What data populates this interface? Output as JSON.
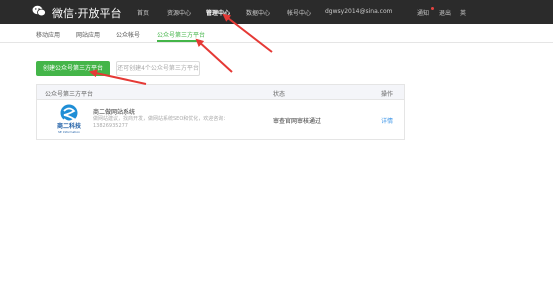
{
  "colors": {
    "topbar_bg": "#2b2b2b",
    "accent_green": "#44b549",
    "annotation_red": "#e53935",
    "link_blue": "#459ae9",
    "notice_dot": "#e64340"
  },
  "header": {
    "logo_icon": "wechat-icon",
    "brand": "微信·开放平台",
    "nav": [
      {
        "label": "首页",
        "active": false
      },
      {
        "label": "资源中心",
        "active": false
      },
      {
        "label": "管理中心",
        "active": true
      },
      {
        "label": "数据中心",
        "active": false
      },
      {
        "label": "帐号中心",
        "active": false
      }
    ],
    "user_email": "dgwsy2014@sina.com",
    "notice_label": "通知",
    "logout_label": "退出",
    "lang_label": "英"
  },
  "subnav": {
    "items": [
      {
        "label": "移动应用",
        "active": false
      },
      {
        "label": "网站应用",
        "active": false
      },
      {
        "label": "公众帐号",
        "active": false
      },
      {
        "label": "公众号第三方平台",
        "active": true
      }
    ]
  },
  "actions": {
    "create_button": "创建公众号第三方平台",
    "secondary_hint": "还可创建4个公众号第三方平台"
  },
  "table": {
    "columns": [
      "公众号第三方平台",
      "状态",
      "操作"
    ],
    "rows": [
      {
        "logo_icon": "company-logo-icon",
        "logo_text": "商二科技",
        "logo_subtext": "SE Information",
        "name": "商二做网站系统",
        "description": "做网站建议，找商开发，做网站系统SEO和优化，欢迎咨询：13826935277",
        "status": "审查官网审核通过",
        "action": "详情"
      }
    ]
  }
}
